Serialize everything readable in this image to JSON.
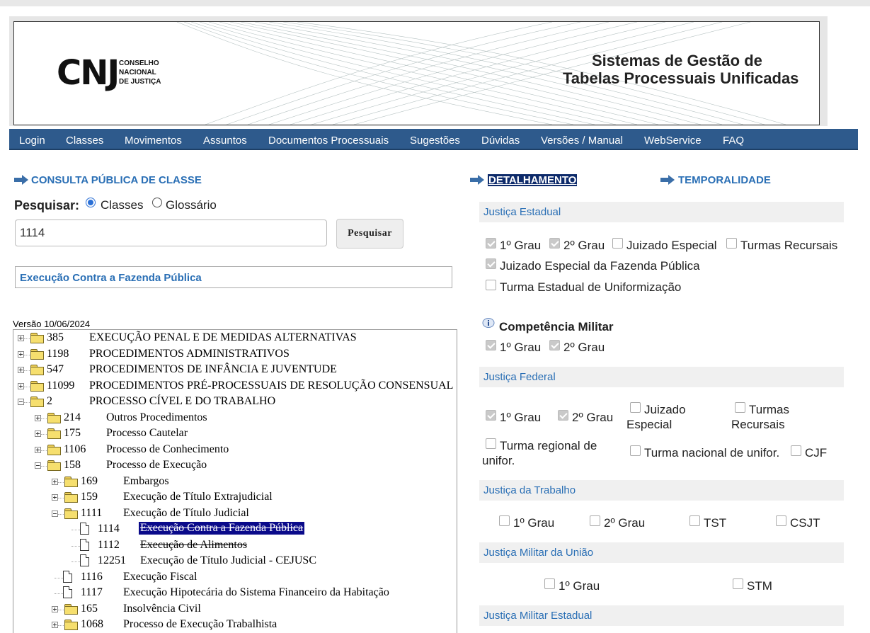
{
  "banner": {
    "logo_letters": "CNJ",
    "logo_text": [
      "CONSELHO",
      "NACIONAL",
      "DE JUSTIÇA"
    ],
    "title_line1": "Sistemas de Gestão de",
    "title_line2": "Tabelas Processuais Unificadas"
  },
  "nav": [
    "Login",
    "Classes",
    "Movimentos",
    "Assuntos",
    "Documentos Processuais",
    "Sugestões",
    "Dúvidas",
    "Versões / Manual",
    "WebService",
    "FAQ"
  ],
  "consulta": {
    "heading": "CONSULTA PÚBLICA DE CLASSE",
    "search_label": "Pesquisar:",
    "radio_classes": "Classes",
    "radio_glossario": "Glossário",
    "selected_radio": "Classes",
    "input_value": "1114",
    "search_button": "Pesquisar",
    "result": "Execução Contra a Fazenda Pública",
    "version": "Versão 10/06/2024"
  },
  "tree": [
    {
      "code": "385",
      "name": "EXECUÇÃO PENAL E DE MEDIDAS ALTERNATIVAS",
      "level": 0,
      "type": "folder",
      "state": "collapsed"
    },
    {
      "code": "1198",
      "name": "PROCEDIMENTOS ADMINISTRATIVOS",
      "level": 0,
      "type": "folder",
      "state": "collapsed"
    },
    {
      "code": "547",
      "name": "PROCEDIMENTOS DE INFÂNCIA E JUVENTUDE",
      "level": 0,
      "type": "folder",
      "state": "collapsed"
    },
    {
      "code": "11099",
      "name": "PROCEDIMENTOS PRÉ-PROCESSUAIS DE RESOLUÇÃO CONSENSUAL",
      "level": 0,
      "type": "folder",
      "state": "collapsed"
    },
    {
      "code": "2",
      "name": "PROCESSO CÍVEL E DO TRABALHO",
      "level": 0,
      "type": "folder",
      "state": "expanded"
    },
    {
      "code": "214",
      "name": "Outros Procedimentos",
      "level": 1,
      "type": "folder",
      "state": "collapsed"
    },
    {
      "code": "175",
      "name": "Processo Cautelar",
      "level": 1,
      "type": "folder",
      "state": "collapsed"
    },
    {
      "code": "1106",
      "name": "Processo de Conhecimento",
      "level": 1,
      "type": "folder",
      "state": "collapsed"
    },
    {
      "code": "158",
      "name": "Processo de Execução",
      "level": 1,
      "type": "folder",
      "state": "expanded"
    },
    {
      "code": "169",
      "name": "Embargos",
      "level": 2,
      "type": "folder",
      "state": "collapsed"
    },
    {
      "code": "159",
      "name": "Execução de Título Extrajudicial",
      "level": 2,
      "type": "folder",
      "state": "collapsed"
    },
    {
      "code": "1111",
      "name": "Execução de Título Judicial",
      "level": 2,
      "type": "folder",
      "state": "expanded"
    },
    {
      "code": "1114",
      "name": "Execução Contra a Fazenda Pública",
      "level": 3,
      "type": "doc",
      "state": "selected"
    },
    {
      "code": "1112",
      "name": "Execução de Alimentos",
      "level": 3,
      "type": "doc",
      "state": "strike"
    },
    {
      "code": "12251",
      "name": "Execução de Título Judicial - CEJUSC",
      "level": 3,
      "type": "doc",
      "state": "normal"
    },
    {
      "code": "1116",
      "name": "Execução Fiscal",
      "level": 2,
      "type": "doc",
      "state": "normal"
    },
    {
      "code": "1117",
      "name": "Execução Hipotecária do Sistema Financeiro da Habitação",
      "level": 2,
      "type": "doc",
      "state": "normal"
    },
    {
      "code": "165",
      "name": "Insolvência Civil",
      "level": 2,
      "type": "folder",
      "state": "collapsed"
    },
    {
      "code": "1068",
      "name": "Processo de Execução Trabalhista",
      "level": 2,
      "type": "folder",
      "state": "collapsed"
    }
  ],
  "detalhamento": {
    "heading": "DETALHAMENTO",
    "temporalidade": "TEMPORALIDADE",
    "estadual": {
      "title": "Justiça Estadual",
      "grau1": "1º Grau",
      "grau2": "2º Grau",
      "juizado": "Juizado Especial",
      "turmas": "Turmas Recursais",
      "fazenda": "Juizado Especial da Fazenda Pública",
      "uniformizacao": "Turma Estadual de Uniformização"
    },
    "militar_comp": {
      "title": "Competência Militar",
      "grau1": "1º Grau",
      "grau2": "2º Grau"
    },
    "federal": {
      "title": "Justiça Federal",
      "grau1": "1º Grau",
      "grau2": "2º Grau",
      "juizado_l1": "Juizado",
      "juizado_l2": "Especial",
      "turmas_l1": "Turmas",
      "turmas_l2": "Recursais",
      "regional_l1": "Turma regional de",
      "regional_l2": "unifor.",
      "nacional": "Turma nacional de unifor.",
      "cjf": "CJF"
    },
    "trabalho": {
      "title": "Justiça da Trabalho",
      "grau1": "1º Grau",
      "grau2": "2º Grau",
      "tst": "TST",
      "csjt": "CSJT"
    },
    "militar_uniao": {
      "title": "Justiça Militar da União",
      "grau1": "1º Grau",
      "stm": "STM"
    },
    "militar_estadual": {
      "title": "Justiça Militar Estadual"
    }
  }
}
